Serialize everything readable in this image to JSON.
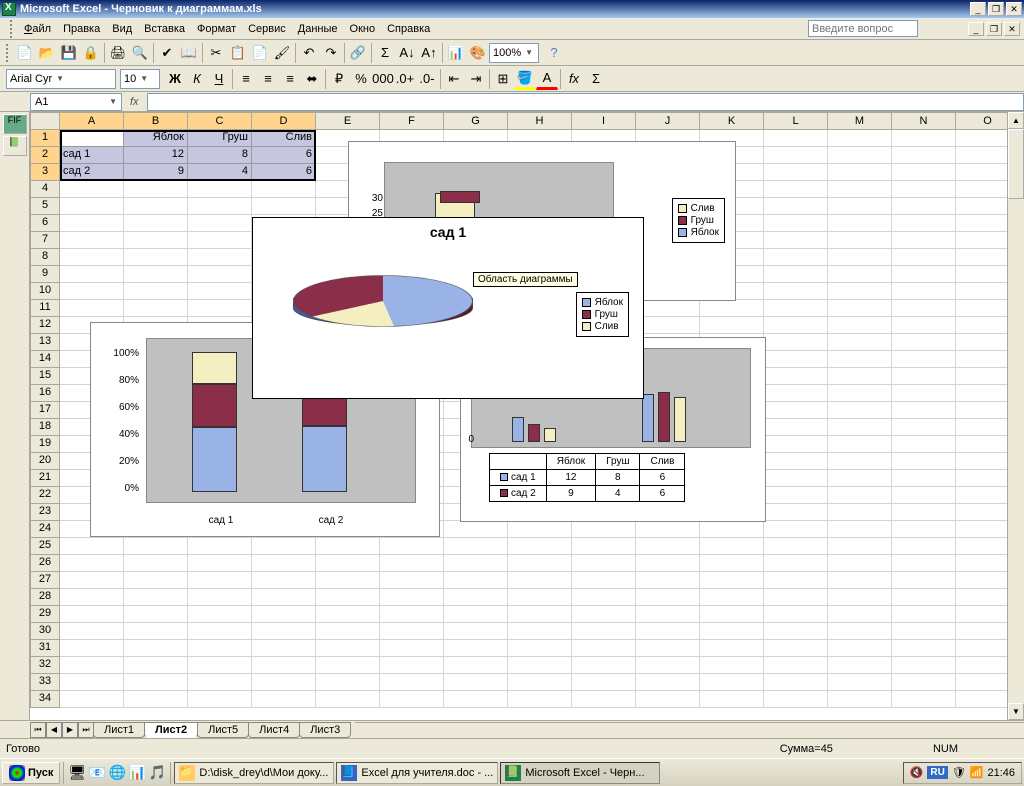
{
  "titlebar": {
    "app": "Microsoft Excel",
    "doc": "Черновик к диаграммам.xls"
  },
  "menu": {
    "file": "Файл",
    "edit": "Правка",
    "view": "Вид",
    "insert": "Вставка",
    "format": "Формат",
    "tools": "Сервис",
    "data": "Данные",
    "window": "Окно",
    "help": "Справка",
    "ask": "Введите вопрос"
  },
  "toolbar": {
    "font": "Arial Cyr",
    "size": "10",
    "zoom": "100%"
  },
  "formula": {
    "cellref": "A1",
    "fx": "fx"
  },
  "columns": [
    "A",
    "B",
    "C",
    "D",
    "E",
    "F",
    "G",
    "H",
    "I",
    "J",
    "K",
    "L",
    "M",
    "N",
    "O"
  ],
  "grid": {
    "r1": {
      "b": "Яблок",
      "c": "Груш",
      "d": "Слив"
    },
    "r2": {
      "a": "сад 1",
      "b": "12",
      "c": "8",
      "d": "6"
    },
    "r3": {
      "a": "сад 2",
      "b": "9",
      "c": "4",
      "d": "6"
    }
  },
  "sheets": {
    "names": [
      "Лист1",
      "Лист2",
      "Лист5",
      "Лист4",
      "Лист3"
    ],
    "active": 1
  },
  "status": {
    "ready": "Готово",
    "sum": "Сумма=45",
    "num": "NUM"
  },
  "taskbar": {
    "start": "Пуск",
    "tasks": [
      "D:\\disk_drey\\d\\Мои доку...",
      "Excel для учителя.doc - ...",
      "Microsoft Excel - Черн..."
    ],
    "lang": "RU",
    "time": "21:46"
  },
  "legend": {
    "sliv": "Слив",
    "grush": "Груш",
    "yablok": "Яблок"
  },
  "colors": {
    "yablok": "#99b3e6",
    "grush": "#8b2e4a",
    "sliv": "#f5eec0"
  },
  "chart4": {
    "title": "сад 1",
    "annot": "Область диаграммы"
  },
  "chart2": {
    "headers": [
      "Яблок",
      "Груш",
      "Слив"
    ],
    "rows": [
      {
        "label": "сад 1",
        "vals": [
          "12",
          "8",
          "6"
        ]
      },
      {
        "label": "сад 2",
        "vals": [
          "9",
          "4",
          "6"
        ]
      }
    ]
  },
  "chart3": {
    "yticks": [
      "0%",
      "20%",
      "40%",
      "60%",
      "80%",
      "100%"
    ],
    "cats": [
      "сад 1",
      "сад 2"
    ]
  },
  "chart1": {
    "yticks": [
      "25",
      "30"
    ]
  },
  "chart_data": [
    {
      "type": "bar",
      "title": "",
      "stacked": true,
      "categories": [
        "сад 1",
        "сад 2"
      ],
      "series": [
        {
          "name": "Яблок",
          "values": [
            12,
            9
          ]
        },
        {
          "name": "Груш",
          "values": [
            8,
            4
          ]
        },
        {
          "name": "Слив",
          "values": [
            6,
            6
          ]
        }
      ],
      "ylim": [
        0,
        30
      ],
      "note": "3D stacked column, upper-right chart (partially obscured)"
    },
    {
      "type": "bar",
      "title": "",
      "categories": [
        "сад 1",
        "сад 2"
      ],
      "series": [
        {
          "name": "Яблок",
          "values": [
            12,
            9
          ]
        },
        {
          "name": "Груш",
          "values": [
            8,
            4
          ]
        },
        {
          "name": "Слив",
          "values": [
            6,
            6
          ]
        }
      ],
      "data_table": true,
      "note": "3D clustered column with data table below, right-center chart"
    },
    {
      "type": "bar",
      "title": "",
      "stacked": true,
      "percent": true,
      "categories": [
        "сад 1",
        "сад 2"
      ],
      "series": [
        {
          "name": "Яблок",
          "values": [
            12,
            9
          ]
        },
        {
          "name": "Груш",
          "values": [
            8,
            4
          ]
        },
        {
          "name": "Слив",
          "values": [
            6,
            6
          ]
        }
      ],
      "ylim": [
        0,
        100
      ],
      "ylabel": "%",
      "note": "3D 100% stacked column, lower-left chart"
    },
    {
      "type": "pie",
      "title": "сад 1",
      "labels": [
        "Яблок",
        "Груш",
        "Слив"
      ],
      "values": [
        12,
        8,
        6
      ],
      "note": "3D pie, frontmost selected chart"
    }
  ]
}
